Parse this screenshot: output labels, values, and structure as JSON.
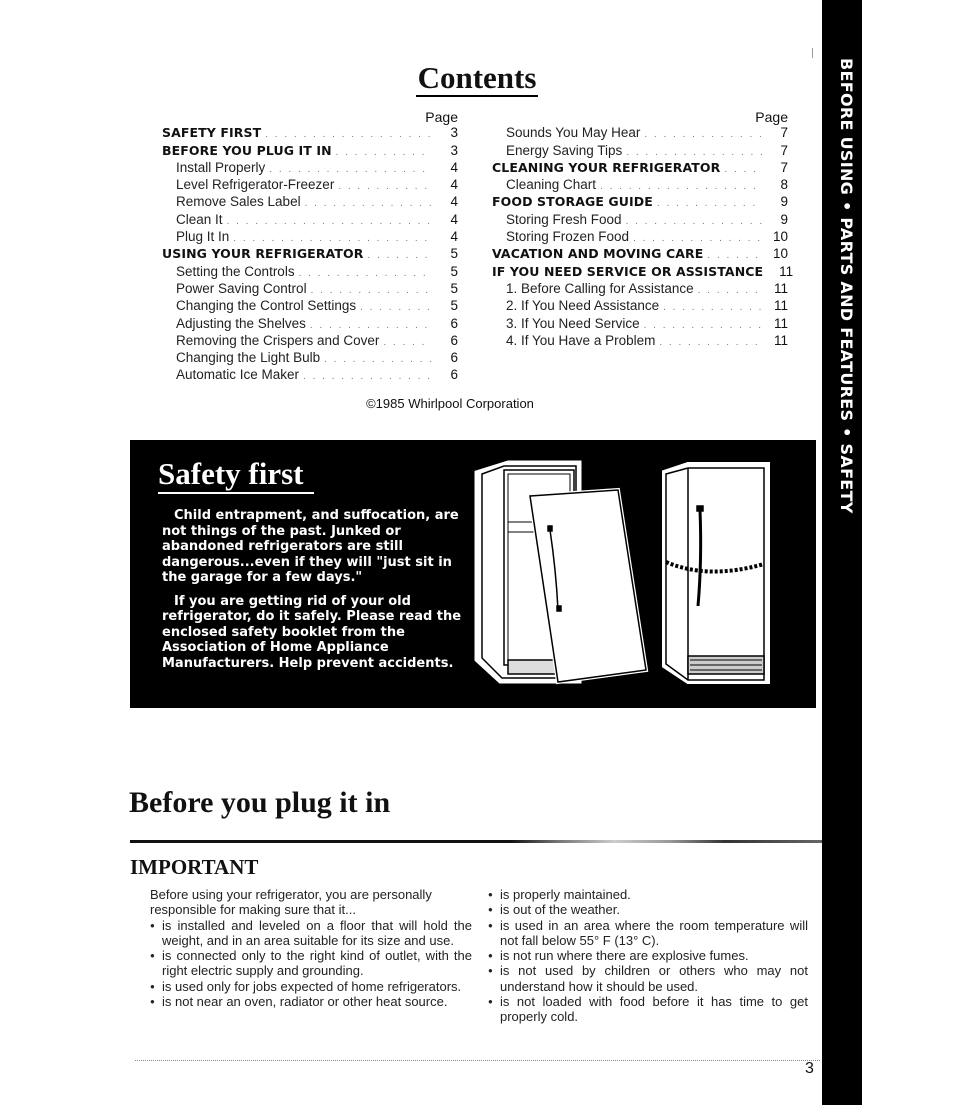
{
  "side_tab": {
    "text": "BEFORE USING • PARTS AND FEATURES • SAFETY"
  },
  "contents": {
    "title": "Contents",
    "page_header": "Page",
    "left": [
      {
        "label": "SAFETY FIRST",
        "page": "3",
        "level": "major"
      },
      {
        "label": "BEFORE YOU PLUG IT IN",
        "page": "3",
        "level": "major"
      },
      {
        "label": "Install Properly",
        "page": "4",
        "level": "minor"
      },
      {
        "label": "Level Refrigerator-Freezer",
        "page": "4",
        "level": "minor"
      },
      {
        "label": "Remove Sales Label",
        "page": "4",
        "level": "minor"
      },
      {
        "label": "Clean It",
        "page": "4",
        "level": "minor"
      },
      {
        "label": "Plug It In",
        "page": "4",
        "level": "minor"
      },
      {
        "label": "USING YOUR REFRIGERATOR",
        "page": "5",
        "level": "major"
      },
      {
        "label": "Setting the Controls",
        "page": "5",
        "level": "minor"
      },
      {
        "label": "Power Saving Control",
        "page": "5",
        "level": "minor"
      },
      {
        "label": "Changing the Control Settings",
        "page": "5",
        "level": "minor"
      },
      {
        "label": "Adjusting the Shelves",
        "page": "6",
        "level": "minor"
      },
      {
        "label": "Removing the Crispers and Cover",
        "page": "6",
        "level": "minor"
      },
      {
        "label": "Changing the Light Bulb",
        "page": "6",
        "level": "minor"
      },
      {
        "label": "Automatic Ice Maker",
        "page": "6",
        "level": "minor"
      }
    ],
    "right": [
      {
        "label": "Sounds You May Hear",
        "page": "7",
        "level": "minor"
      },
      {
        "label": "Energy Saving Tips",
        "page": "7",
        "level": "minor"
      },
      {
        "label": "CLEANING YOUR REFRIGERATOR",
        "page": "7",
        "level": "major"
      },
      {
        "label": "Cleaning Chart",
        "page": "8",
        "level": "minor"
      },
      {
        "label": "FOOD STORAGE GUIDE",
        "page": "9",
        "level": "major"
      },
      {
        "label": "Storing Fresh Food",
        "page": "9",
        "level": "minor"
      },
      {
        "label": "Storing Frozen Food",
        "page": "10",
        "level": "minor"
      },
      {
        "label": "VACATION AND MOVING CARE",
        "page": "10",
        "level": "major"
      },
      {
        "label": "IF YOU NEED SERVICE OR ASSISTANCE",
        "page": "11",
        "level": "major"
      },
      {
        "label": "1. Before Calling for Assistance",
        "page": "11",
        "level": "minor"
      },
      {
        "label": "2. If You Need Assistance",
        "page": "11",
        "level": "minor"
      },
      {
        "label": "3. If You Need Service",
        "page": "11",
        "level": "minor"
      },
      {
        "label": "4. If You Have a Problem",
        "page": "11",
        "level": "minor"
      }
    ]
  },
  "copyright": "©1985 Whirlpool Corporation",
  "safety": {
    "title": "Safety first",
    "paragraphs": [
      "Child entrapment, and suffocation, are not things of the past. Junked or abandoned refrigerators are still dangerous...even if they will \"just sit in the garage for a few days.\"",
      "If you are getting rid of your old refrigerator, do it safely. Please read the enclosed safety booklet from the Association of Home Appliance Manufacturers. Help prevent accidents."
    ],
    "illustration": "refrigerator-door-removed-and-chained-refrigerator"
  },
  "before_plug": {
    "title": "Before you plug it in",
    "subtitle": "IMPORTANT",
    "intro": "Before using your refrigerator, you are personally responsible for making sure that it...",
    "left_bullets": [
      "is installed and leveled on a floor that will hold the weight, and in an area suitable for its size and use.",
      "is connected only to the right kind of outlet, with the right electric supply and grounding.",
      "is used only for jobs expected of home refrigerators.",
      "is not near an oven, radiator or other heat source."
    ],
    "right_bullets": [
      "is properly maintained.",
      "is out of the weather.",
      "is used in an area where the room temperature will not fall below 55° F (13° C).",
      "is not run where there are explosive fumes.",
      "is not used by children or others who may not understand how it should be used.",
      "is not loaded with food before it has time to get properly cold."
    ]
  },
  "page_number": "3"
}
